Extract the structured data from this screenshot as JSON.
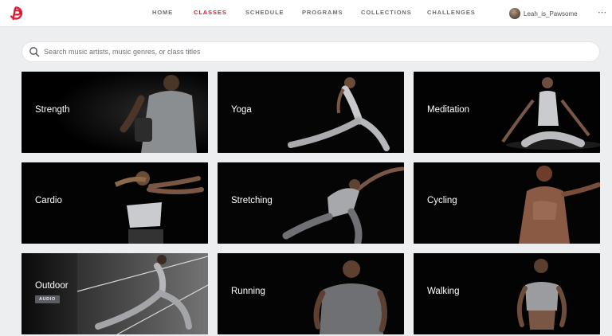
{
  "nav": {
    "items": [
      {
        "label": "HOME",
        "active": false
      },
      {
        "label": "CLASSES",
        "active": true
      },
      {
        "label": "SCHEDULE",
        "active": false
      },
      {
        "label": "PROGRAMS",
        "active": false
      },
      {
        "label": "COLLECTIONS",
        "active": false
      },
      {
        "label": "CHALLENGES",
        "active": false
      }
    ],
    "username": "Leah_is_Pawsome",
    "more_icon": "ellipsis-icon",
    "logo_icon": "peloton-logo-icon"
  },
  "search": {
    "placeholder": "Search music artists, music genres, or class titles",
    "value": "",
    "icon": "search-icon"
  },
  "colors": {
    "accent": "#df1c2f",
    "card_bg": "#000000",
    "page_bg": "#eceef0"
  },
  "categories": [
    {
      "label": "Strength"
    },
    {
      "label": "Yoga"
    },
    {
      "label": "Meditation"
    },
    {
      "label": "Cardio"
    },
    {
      "label": "Stretching"
    },
    {
      "label": "Cycling"
    },
    {
      "label": "Outdoor",
      "badge": "AUDIO"
    },
    {
      "label": "Running"
    },
    {
      "label": "Walking"
    }
  ]
}
